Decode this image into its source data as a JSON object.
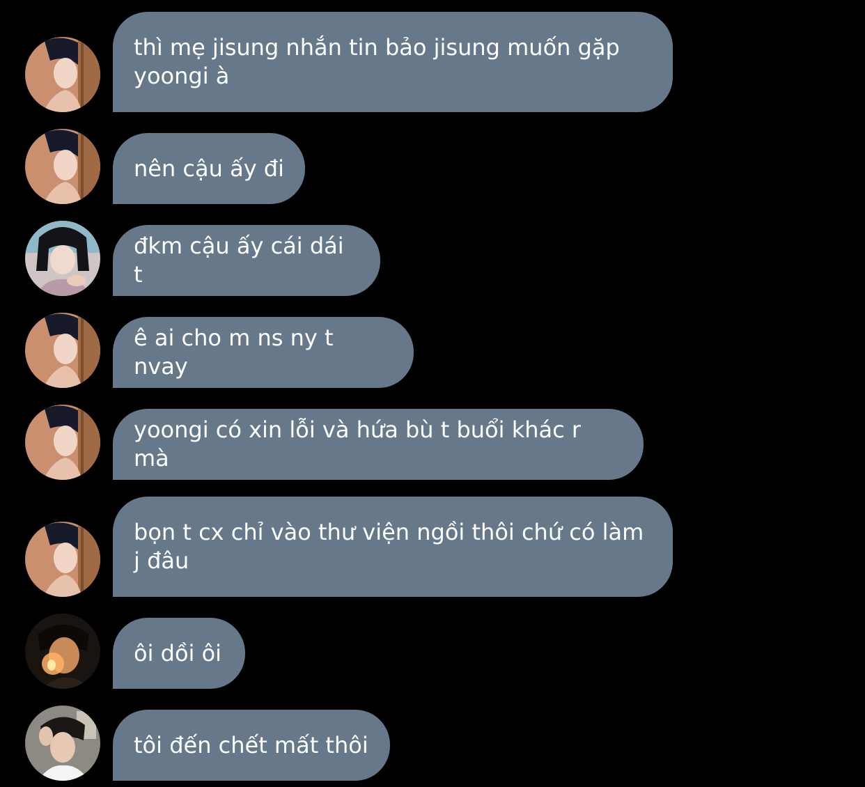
{
  "messages": [
    {
      "sender": "boy-dark-hair-a",
      "text": "thì mẹ jisung nhắn tin bảo jisung muốn gặp yoongi à"
    },
    {
      "sender": "boy-dark-hair-a",
      "text": "nên cậu ấy đi"
    },
    {
      "sender": "girl-bob-hair",
      "text": "đkm cậu ấy cái dái t"
    },
    {
      "sender": "boy-dark-hair-a",
      "text": "ê ai cho m ns ny t nvay"
    },
    {
      "sender": "boy-dark-hair-a",
      "text": "yoongi có xin lỗi và hứa bù t buổi khác r mà"
    },
    {
      "sender": "boy-dark-hair-a",
      "text": "bọn t cx chỉ vào thư viện ngồi thôi chứ có làm j đâu"
    },
    {
      "sender": "boy-candle",
      "text": "ôi dồi ôi"
    },
    {
      "sender": "boy-hand-on-head",
      "text": "tôi đến chết mất thôi"
    }
  ],
  "colors": {
    "background": "#000000",
    "bubble": "#667889",
    "text": "#ffffff"
  }
}
